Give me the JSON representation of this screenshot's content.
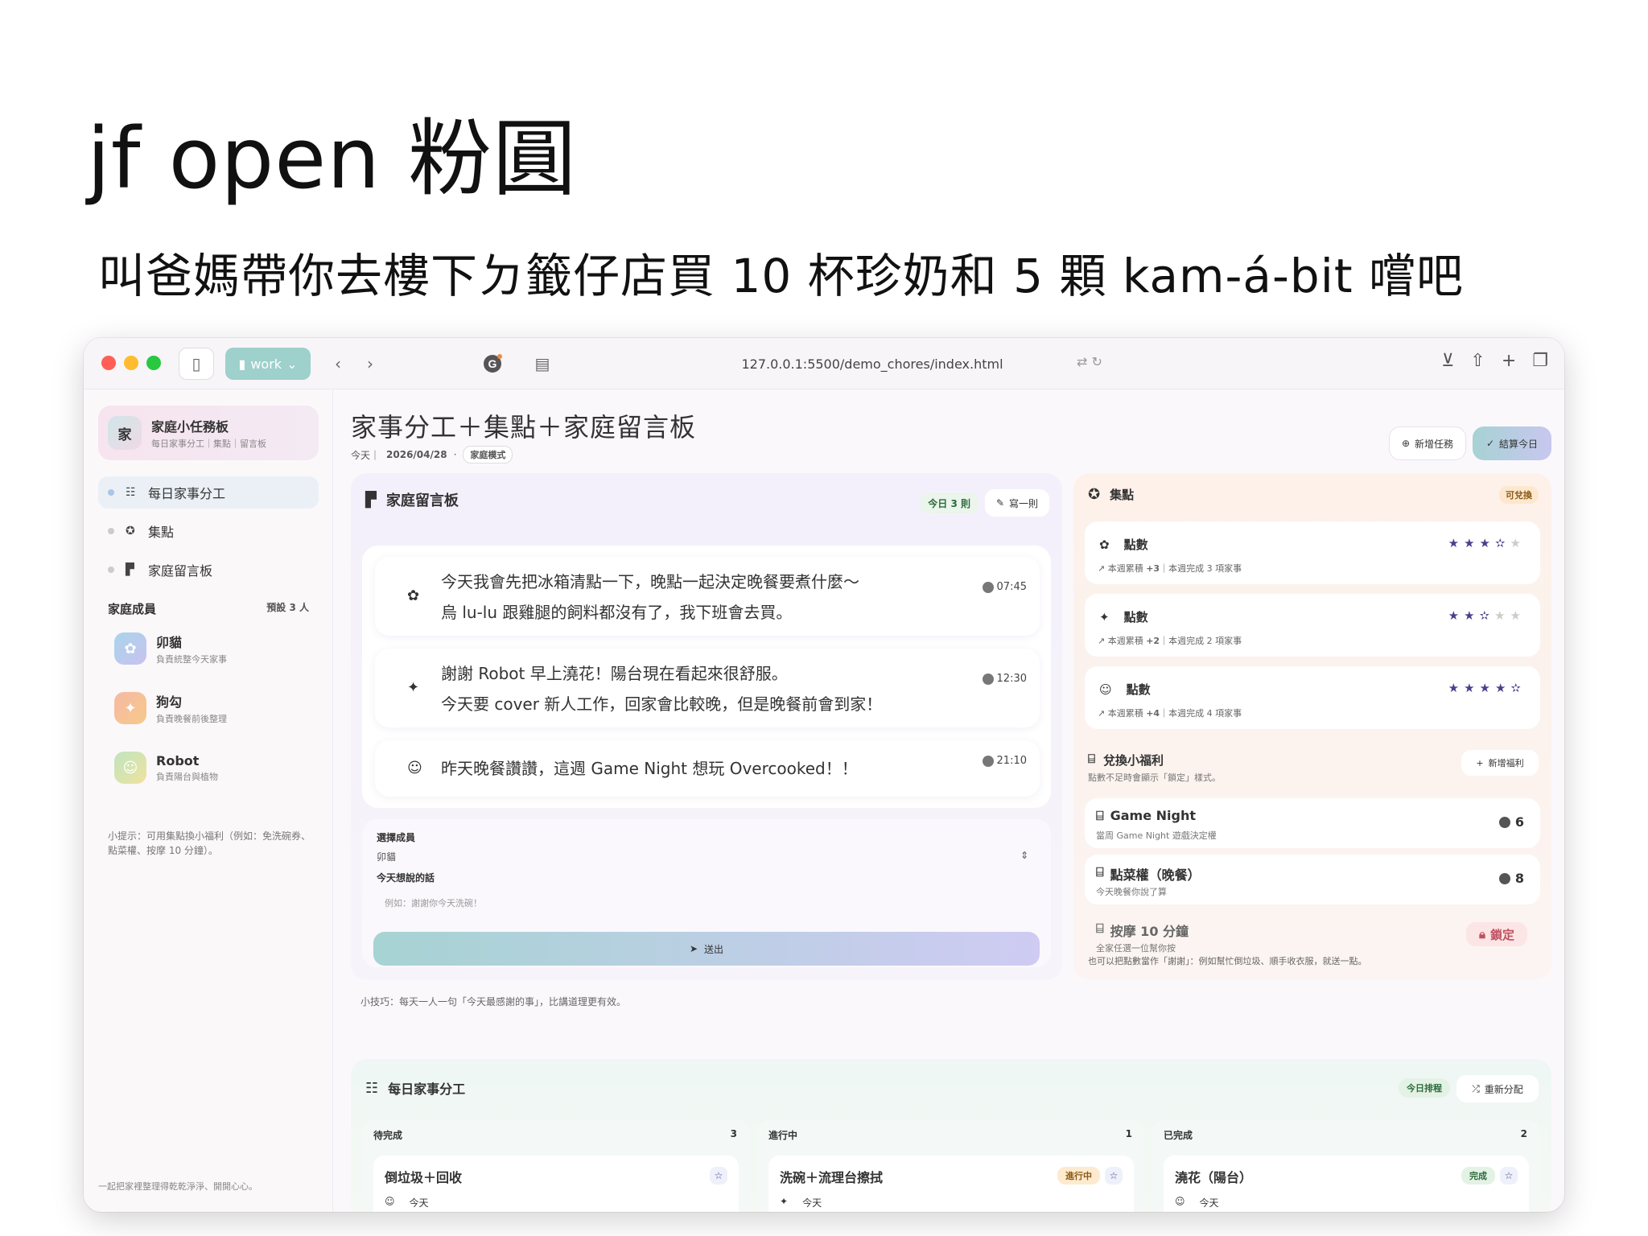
{
  "hero": {
    "title": "jf open 粉圓",
    "subtitle": "叫爸媽帶你去樓下ㄉ籤仔店買 10 杯珍奶和 5 顆 kam-á-bit 嚐吧"
  },
  "browser": {
    "profile": "work",
    "url": "127.0.0.1:5500/demo_chores/index.html"
  },
  "sidebar": {
    "brand_avatar": "家",
    "brand_name": "家庭小任務板",
    "brand_tagline": "每日家事分工｜集點｜留言板",
    "nav": [
      {
        "label": "每日家事分工"
      },
      {
        "label": "集點"
      },
      {
        "label": "家庭留言板"
      }
    ],
    "members_title": "家庭成員",
    "members_count": "預設 3 人",
    "members": [
      {
        "name": "卯貓",
        "role": "負責統整今天家事"
      },
      {
        "name": "狗勾",
        "role": "負責晚餐前後整理"
      },
      {
        "name": "Robot",
        "role": "負責陽台與植物"
      }
    ],
    "tip": "小提示：可用集點換小福利（例如：免洗碗券、點菜權、按摩 10 分鐘）。",
    "footer": "一起把家裡整理得乾乾淨淨、開開心心。"
  },
  "header": {
    "title": "家事分工＋集點＋家庭留言板",
    "today_label": "今天｜",
    "date": "2026/04/28",
    "mode": "家庭模式",
    "new_task": "新增任務",
    "settle": "結算今日"
  },
  "board": {
    "title": "家庭留言板",
    "today_count": "今日 3 則",
    "write": "寫一則",
    "messages": [
      {
        "line1": "今天我會先把冰箱清點一下，晚點一起決定晚餐要煮什麼～",
        "line2": "烏 lu-lu 跟雞腿的飼料都沒有了，我下班會去買。",
        "time": "07:45"
      },
      {
        "line1": "謝謝 Robot 早上澆花！陽台現在看起來很舒服。",
        "line2": "今天要 cover 新人工作，回家會比較晚，但是晚餐前會到家！",
        "time": "12:30"
      },
      {
        "line1": "昨天晚餐讚讚，這週 Game Night 想玩 Overcooked！！",
        "line2": "",
        "time": "21:10"
      }
    ],
    "select_label": "選擇成員",
    "select_value": "卯貓",
    "message_label": "今天想說的話",
    "message_placeholder": "例如：謝謝你今天洗碗！",
    "send": "送出",
    "tip": "小技巧：每天一人一句「今天最感謝的事」，比講道理更有效。"
  },
  "points": {
    "title": "集點",
    "badge": "可兌換",
    "rows": [
      {
        "label": "點數",
        "sub_prefix": "本週累積",
        "delta": "+3",
        "sub_suffix": "｜本週完成 3 項家事",
        "stars": 3.5
      },
      {
        "label": "點數",
        "sub_prefix": "本週累積",
        "delta": "+2",
        "sub_suffix": "｜本週完成 2 項家事",
        "stars": 2.5
      },
      {
        "label": "點數",
        "sub_prefix": "本週累積",
        "delta": "+4",
        "sub_suffix": "｜本週完成 4 項家事",
        "stars": 4.5
      }
    ],
    "rewards_title": "兌換小福利",
    "rewards_note": "點數不足時會顯示「鎖定」樣式。",
    "add_reward": "新增福利",
    "rewards": [
      {
        "name": "Game Night",
        "desc": "當周 Game Night 遊戲決定權",
        "cost": "6"
      },
      {
        "name": "點菜權（晚餐）",
        "desc": "今天晚餐你說了算",
        "cost": "8"
      },
      {
        "name": "按摩 10 分鐘",
        "desc": "全家任選一位幫你按",
        "status": "鎖定"
      }
    ],
    "footer": "也可以把點數當作「謝謝」：例如幫忙倒垃圾、順手收衣服，就送一點。"
  },
  "chores": {
    "title": "每日家事分工",
    "badge": "今日排程",
    "realloc": "重新分配",
    "columns": [
      {
        "title": "待完成",
        "count": "3",
        "task": "倒垃圾＋回收",
        "due": "今天",
        "tag": ""
      },
      {
        "title": "進行中",
        "count": "1",
        "task": "洗碗＋流理台擦拭",
        "due": "今天",
        "tag": "進行中"
      },
      {
        "title": "已完成",
        "count": "2",
        "task": "澆花（陽台）",
        "due": "今天",
        "tag": "完成"
      }
    ]
  },
  "colors": {
    "accent_teal": "#a7d2d4",
    "accent_lavender": "#c8c7ef",
    "star": "#4a3f8a",
    "lock": "#c05060"
  }
}
